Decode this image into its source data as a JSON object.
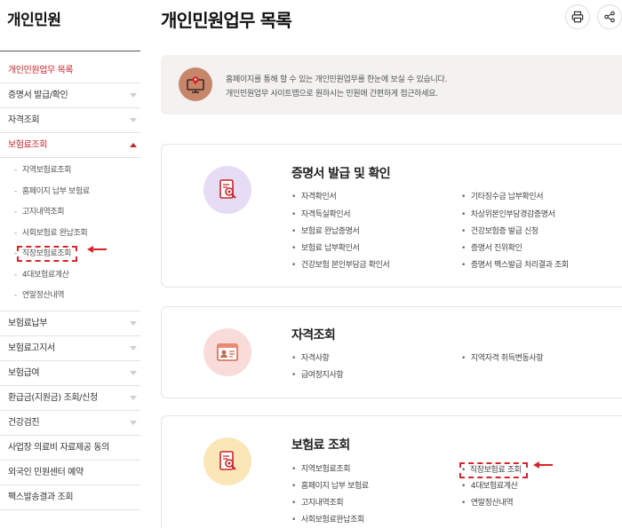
{
  "sidebar": {
    "title": "개인민원",
    "items": [
      {
        "label": "개인민원업무 목록",
        "active": true
      },
      {
        "label": "증명서 발급/확인"
      },
      {
        "label": "자격조회"
      },
      {
        "label": "보험료조회",
        "active": true
      }
    ],
    "sub_items": [
      "지역보험료조회",
      "홈페이지 납부 보험료",
      "고지내역조회",
      "사회보험료 완납조회",
      "직장보험료조회",
      "4대보험료계산",
      "연말정산내역"
    ],
    "items_after": [
      {
        "label": "보험료납부"
      },
      {
        "label": "보험료고지서"
      },
      {
        "label": "보험급여"
      },
      {
        "label": "환급금(지원금) 조회/신청"
      },
      {
        "label": "건강검진"
      },
      {
        "label": "사업장 의료비 자료제공 동의"
      },
      {
        "label": "외국인 민원센터 예약"
      },
      {
        "label": "팩스발송결과 조회"
      }
    ]
  },
  "header": {
    "title": "개인민원업무 목록",
    "print_icon": "printer-icon",
    "share_icon": "share-icon"
  },
  "notice": {
    "line1": "홈페이지를 통해 할 수 있는 개인민원업무를 한눈에 보실 수 있습니다.",
    "line2": "개인민원업무 사이트맵으로 원하시는 민원에 간편하게 접근하세요."
  },
  "cards": [
    {
      "title": "증명서 발급 및 확인",
      "left": [
        "자격확인서",
        "자격득실확인서",
        "보험료 완납증명서",
        "보험료 납부확인서",
        "건강보험 본인부담금 확인서"
      ],
      "right": [
        "기타징수금 납부확인서",
        "차상위본인부담경감증명서",
        "건강보험증 발급 신청",
        "증명서 진위확인",
        "증명서 팩스발급 처리결과 조회"
      ]
    },
    {
      "title": "자격조회",
      "left": [
        "자격사항",
        "급여정지사항"
      ],
      "right": [
        "지역자격 취득변동사항"
      ]
    },
    {
      "title": "보험료 조회",
      "left": [
        "지역보험료조회",
        "홈페이지 납부 보험료",
        "고지내역조회",
        "사회보험료완납조회"
      ],
      "right": [
        "직장보험료 조회",
        "4대보험료계산",
        "연말정산내역"
      ]
    }
  ],
  "colors": {
    "accent": "#c8252c",
    "highlight": "#d8232a",
    "card1_icon_bg": "#e6dcf6",
    "card2_icon_bg": "#f9dcda",
    "card3_icon_bg": "#fbe6b8",
    "notice_icon_bg": "#c7866a"
  }
}
